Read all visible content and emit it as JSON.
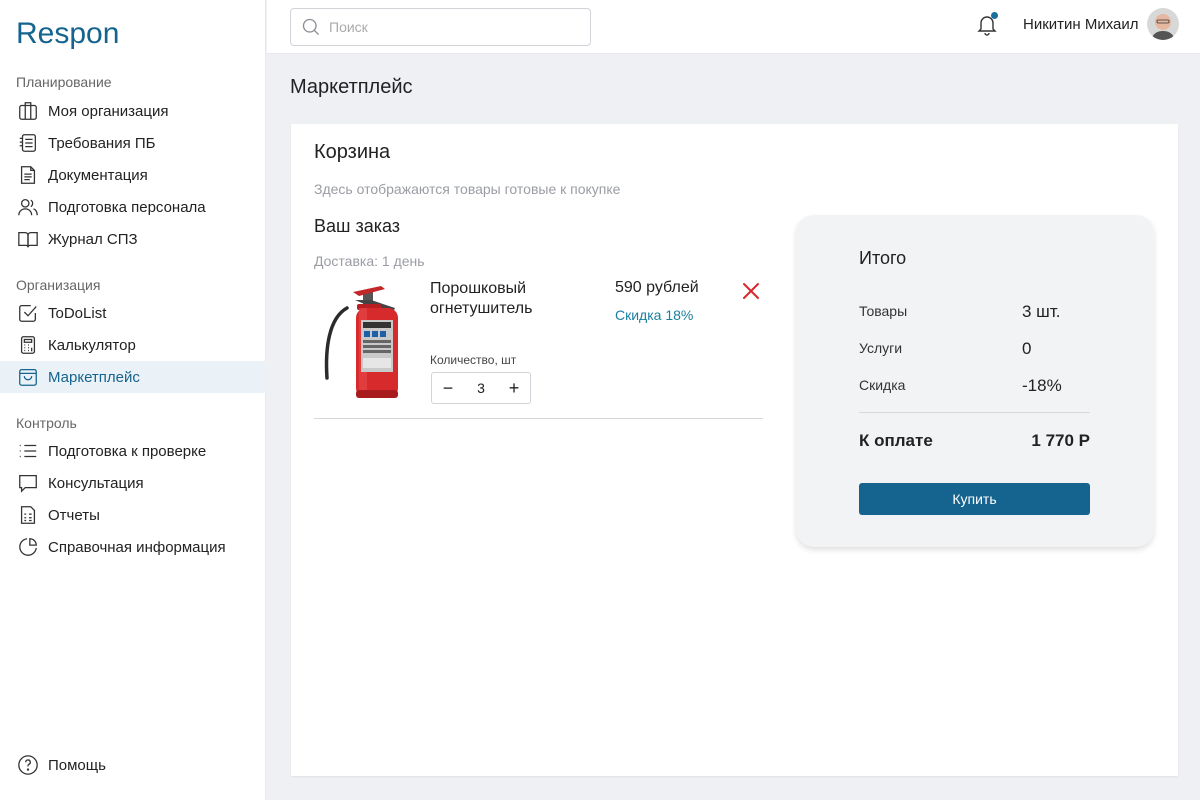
{
  "brand": {
    "logo_text": "Respon",
    "accent": "#15648f"
  },
  "sidebar": {
    "sections": [
      {
        "title": "Планирование",
        "items": [
          {
            "label": "Моя организация",
            "icon": "building-icon"
          },
          {
            "label": "Требования ПБ",
            "icon": "document-list-icon"
          },
          {
            "label": "Документация",
            "icon": "file-icon"
          },
          {
            "label": "Подготовка персонала",
            "icon": "users-icon"
          },
          {
            "label": "Журнал СПЗ",
            "icon": "book-icon"
          }
        ]
      },
      {
        "title": "Организация",
        "items": [
          {
            "label": "ToDoList",
            "icon": "checkbox-icon"
          },
          {
            "label": "Калькулятор",
            "icon": "calculator-icon"
          },
          {
            "label": "Маркетплейс",
            "icon": "shopping-bag-icon",
            "active": true
          }
        ]
      },
      {
        "title": "Контроль",
        "items": [
          {
            "label": "Подготовка к проверке",
            "icon": "list-icon"
          },
          {
            "label": "Консультация",
            "icon": "chat-icon"
          },
          {
            "label": "Отчеты",
            "icon": "report-icon"
          },
          {
            "label": "Справочная информация",
            "icon": "pie-chart-icon"
          }
        ]
      }
    ],
    "help_label": "Помощь"
  },
  "topbar": {
    "search_placeholder": "Поиск",
    "user_name": "Никитин Михаил"
  },
  "page": {
    "title": "Маркетплейс"
  },
  "cart": {
    "title": "Корзина",
    "subtitle": "Здесь отображаются товары готовые к покупке",
    "order_title": "Ваш заказ",
    "delivery": "Доставка: 1 день",
    "item": {
      "name": "Порошковый огнетушитель",
      "price": "590 рублей",
      "discount": "Скидка 18%",
      "quantity_label": "Количество, шт",
      "quantity": "3",
      "minus": "−",
      "plus": "+"
    }
  },
  "summary": {
    "title": "Итого",
    "rows": [
      {
        "label": "Товары",
        "value": "3 шт."
      },
      {
        "label": "Услуги",
        "value": "0"
      },
      {
        "label": "Скидка",
        "value": "-18%"
      }
    ],
    "total_label": "К оплате",
    "total_value": "1 770 Р",
    "buy_label": "Купить"
  }
}
